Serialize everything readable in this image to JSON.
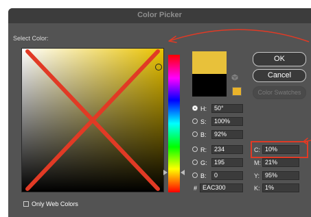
{
  "window": {
    "title": "Color Picker"
  },
  "labels": {
    "select_color": "Select Color:",
    "only_web_colors": "Only Web Colors"
  },
  "buttons": {
    "ok": "OK",
    "cancel": "Cancel",
    "color_swatches": "Color Swatches"
  },
  "hsb": [
    {
      "label": "H:",
      "value": "50°",
      "selected": true
    },
    {
      "label": "S:",
      "value": "100%",
      "selected": false
    },
    {
      "label": "B:",
      "value": "92%",
      "selected": false
    }
  ],
  "rgb": [
    {
      "label": "R:",
      "value": "234",
      "selected": false
    },
    {
      "label": "G:",
      "value": "195",
      "selected": false
    },
    {
      "label": "B:",
      "value": "0",
      "selected": false
    }
  ],
  "hex": {
    "label": "#",
    "value": "EAC300"
  },
  "cmyk": [
    {
      "label": "C:",
      "value": "10%"
    },
    {
      "label": "M:",
      "value": "21%"
    },
    {
      "label": "Y:",
      "value": "95%"
    },
    {
      "label": "K:",
      "value": "1%"
    }
  ],
  "colors": {
    "new_color": "#e8c13a",
    "old_color": "#000000",
    "hue": "#eac300",
    "annotation": "#e13a25",
    "dialog_bg": "#535353"
  }
}
